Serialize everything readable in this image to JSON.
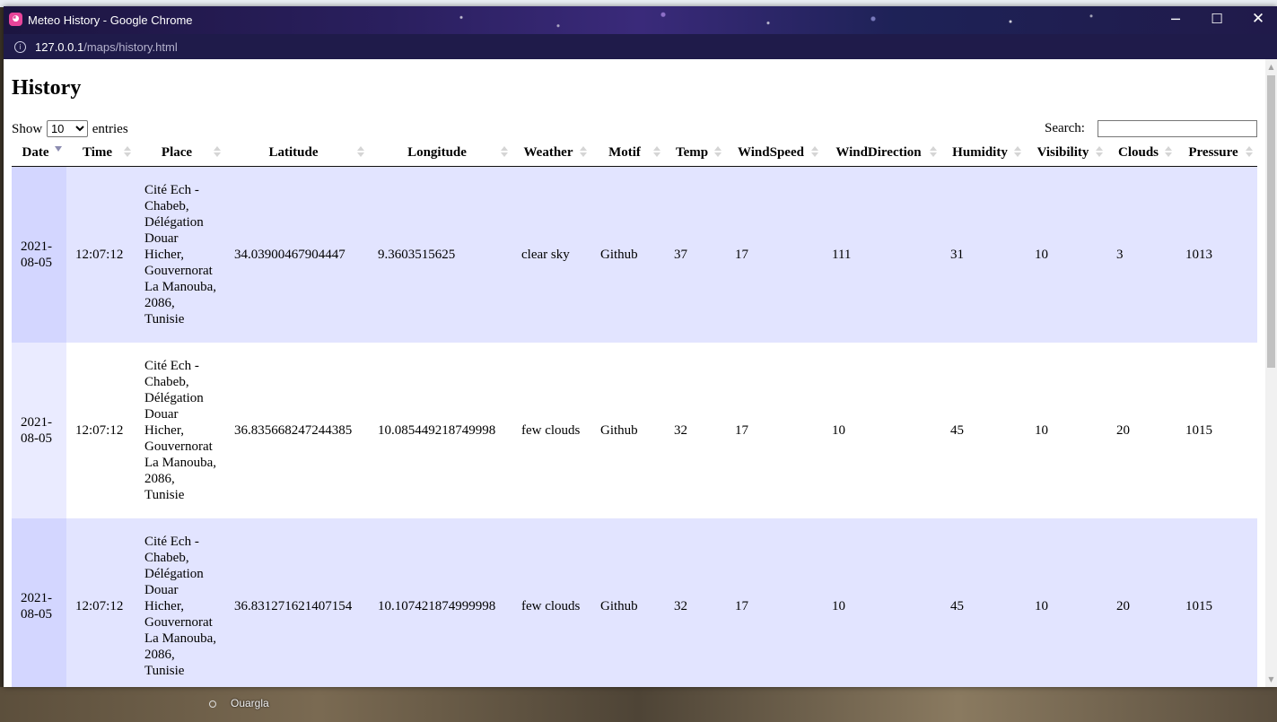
{
  "window": {
    "title": "Meteo History - Google Chrome",
    "url_host": "127.0.0.1",
    "url_path": "/maps/history.html",
    "controls": {
      "minimize": "─",
      "maximize": "☐",
      "close": "✕"
    }
  },
  "desktop": {
    "map_label": "Ouargla"
  },
  "page": {
    "heading": "History",
    "show_label": "Show",
    "entries_label": "entries",
    "page_length": "10",
    "search_label": "Search:",
    "search_value": ""
  },
  "table": {
    "sorted_column": "Date",
    "columns": [
      "Date",
      "Time",
      "Place",
      "Latitude",
      "Longitude",
      "Weather",
      "Motif",
      "Temp",
      "WindSpeed",
      "WindDirection",
      "Humidity",
      "Visibility",
      "Clouds",
      "Pressure"
    ],
    "rows": [
      [
        "2021-08-05",
        "12:07:12",
        "Cité Ech - Chabeb, Délégation Douar Hicher, Gouvernorat La Manouba, 2086, Tunisie",
        "34.03900467904447",
        "9.3603515625",
        "clear sky",
        "Github",
        "37",
        "17",
        "111",
        "31",
        "10",
        "3",
        "1013"
      ],
      [
        "2021-08-05",
        "12:07:12",
        "Cité Ech - Chabeb, Délégation Douar Hicher, Gouvernorat La Manouba, 2086, Tunisie",
        "36.835668247244385",
        "10.085449218749998",
        "few clouds",
        "Github",
        "32",
        "17",
        "10",
        "45",
        "10",
        "20",
        "1015"
      ],
      [
        "2021-08-05",
        "12:07:12",
        "Cité Ech - Chabeb, Délégation Douar Hicher, Gouvernorat La Manouba, 2086, Tunisie",
        "36.831271621407154",
        "10.107421874999998",
        "few clouds",
        "Github",
        "32",
        "17",
        "10",
        "45",
        "10",
        "20",
        "1015"
      ]
    ]
  },
  "colors": {
    "odd_row": "#e2e4ff",
    "odd_row_sorted": "#d3d6ff",
    "even_row_sorted": "#eaebff",
    "titlebar": "#2a1f5e"
  }
}
